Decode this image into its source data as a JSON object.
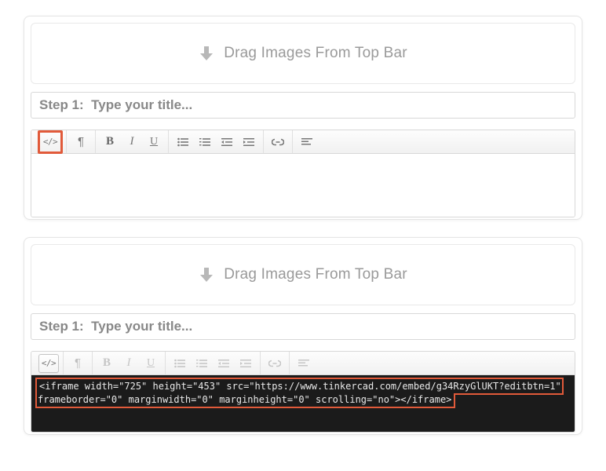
{
  "panel1": {
    "dropzone_text": "Drag Images From Top Bar",
    "title_placeholder": "Step 1:  Type your title...",
    "html_mode_active": false,
    "code_highlight": true,
    "content_dark": false
  },
  "panel2": {
    "dropzone_text": "Drag Images From Top Bar",
    "title_placeholder": "Step 1:  Type your title...",
    "html_mode_active": true,
    "code_highlight": false,
    "content_dark": true,
    "code_text": "<iframe width=\"725\" height=\"453\" src=\"https://www.tinkercad.com/embed/g34RzyGlUKT?editbtn=1\" frameborder=\"0\" marginwidth=\"0\" marginheight=\"0\" scrolling=\"no\"></iframe>"
  },
  "toolbar": {
    "code": "</>",
    "paragraph": "¶",
    "bold": "B",
    "italic": "I",
    "underline": "U"
  }
}
